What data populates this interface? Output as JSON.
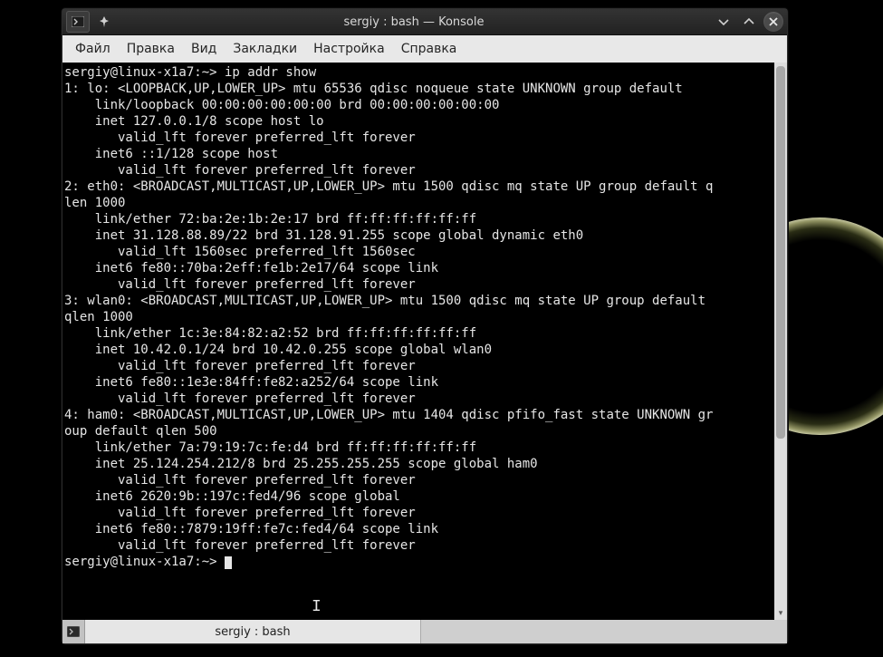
{
  "window": {
    "title": "sergiy : bash — Konsole"
  },
  "menubar": {
    "items": [
      "Файл",
      "Правка",
      "Вид",
      "Закладки",
      "Настройка",
      "Справка"
    ]
  },
  "terminal": {
    "prompt": "sergiy@linux-x1a7:~>",
    "command": "ip addr show",
    "output_lines": [
      "1: lo: <LOOPBACK,UP,LOWER_UP> mtu 65536 qdisc noqueue state UNKNOWN group default",
      "    link/loopback 00:00:00:00:00:00 brd 00:00:00:00:00:00",
      "    inet 127.0.0.1/8 scope host lo",
      "       valid_lft forever preferred_lft forever",
      "    inet6 ::1/128 scope host",
      "       valid_lft forever preferred_lft forever",
      "2: eth0: <BROADCAST,MULTICAST,UP,LOWER_UP> mtu 1500 qdisc mq state UP group default q",
      "len 1000",
      "    link/ether 72:ba:2e:1b:2e:17 brd ff:ff:ff:ff:ff:ff",
      "    inet 31.128.88.89/22 brd 31.128.91.255 scope global dynamic eth0",
      "       valid_lft 1560sec preferred_lft 1560sec",
      "    inet6 fe80::70ba:2eff:fe1b:2e17/64 scope link",
      "       valid_lft forever preferred_lft forever",
      "3: wlan0: <BROADCAST,MULTICAST,UP,LOWER_UP> mtu 1500 qdisc mq state UP group default ",
      "qlen 1000",
      "    link/ether 1c:3e:84:82:a2:52 brd ff:ff:ff:ff:ff:ff",
      "    inet 10.42.0.1/24 brd 10.42.0.255 scope global wlan0",
      "       valid_lft forever preferred_lft forever",
      "    inet6 fe80::1e3e:84ff:fe82:a252/64 scope link",
      "       valid_lft forever preferred_lft forever",
      "4: ham0: <BROADCAST,MULTICAST,UP,LOWER_UP> mtu 1404 qdisc pfifo_fast state UNKNOWN gr",
      "oup default qlen 500",
      "    link/ether 7a:79:19:7c:fe:d4 brd ff:ff:ff:ff:ff:ff",
      "    inet 25.124.254.212/8 brd 25.255.255.255 scope global ham0",
      "       valid_lft forever preferred_lft forever",
      "    inet6 2620:9b::197c:fed4/96 scope global",
      "       valid_lft forever preferred_lft forever",
      "    inet6 fe80::7879:19ff:fe7c:fed4/64 scope link",
      "       valid_lft forever preferred_lft forever"
    ]
  },
  "tab": {
    "label": "sergiy : bash"
  },
  "icons": {
    "new_tab_glyph": ">_",
    "pin_glyph": "📌",
    "min_glyph": "⌄",
    "max_glyph": "⌃",
    "close_glyph": "✕"
  }
}
